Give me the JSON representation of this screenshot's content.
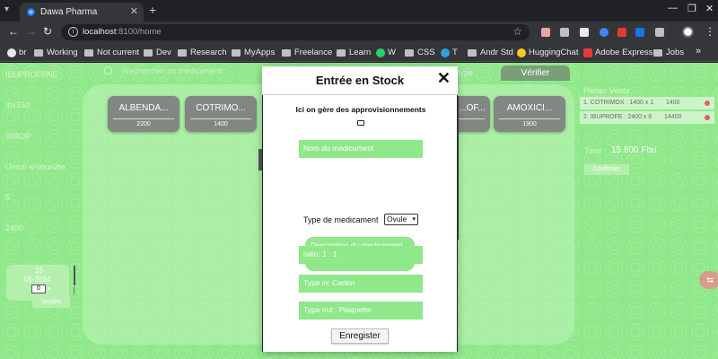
{
  "browser": {
    "tab_title": "Dawa Pharma",
    "url_host": "localhost",
    "url_path": ":8100/home",
    "bookmarks": [
      "br",
      "Working",
      "Not current",
      "Dev",
      "Research",
      "MyApps",
      "Freelance",
      "Learn",
      "W",
      "CSS",
      "T",
      "Andr Std",
      "HuggingChat",
      "Adobe Express",
      "Jobs"
    ]
  },
  "left": {
    "items": [
      "IBUPROFENE",
      "Ibx33d",
      "SIROP",
      "Umuti w'uburuhe",
      "5",
      "2400"
    ],
    "date_day": "15",
    "date_month_year": "05-2024",
    "qty": "0",
    "sell_button": "Vendre"
  },
  "search": {
    "placeholder": "Rechercher un medicament"
  },
  "verify_button": "Vérifier",
  "grid_link": "type",
  "products": [
    {
      "name": "ALBENDA...",
      "value": "2200"
    },
    {
      "name": "COTRIMO...",
      "value": "1400"
    },
    {
      "name": "...OF...",
      "value": ""
    },
    {
      "name": "AMOXICI...",
      "value": "1900"
    }
  ],
  "cart": {
    "title": "Panier Vente",
    "items": [
      {
        "label": "1. COTRIMOX : 1400 x 1",
        "amount": "1400"
      },
      {
        "label": "2. IBUPROFE : 2400 x 6",
        "amount": "14400"
      }
    ],
    "total_label": "Total :",
    "total_value": "15.800 Fbu",
    "confirm_button": "Confirmer"
  },
  "modal": {
    "title": "Entrée en Stock",
    "subtitle": "Ici on gère des approvisionnements",
    "name_placeholder": "Nom du medicament",
    "type_label": "Type de medicament",
    "type_value": "Ovule",
    "description_placeholder": "Description du medicament",
    "ratio": "ratio: 1 : 1",
    "type_in": "Type in: Carton",
    "type_out": "Type out : Plaquette",
    "save_button": "Enregister"
  },
  "colors": {
    "page_green": "#8fe889",
    "card_gray": "#838783",
    "browser_dark": "#202124"
  }
}
